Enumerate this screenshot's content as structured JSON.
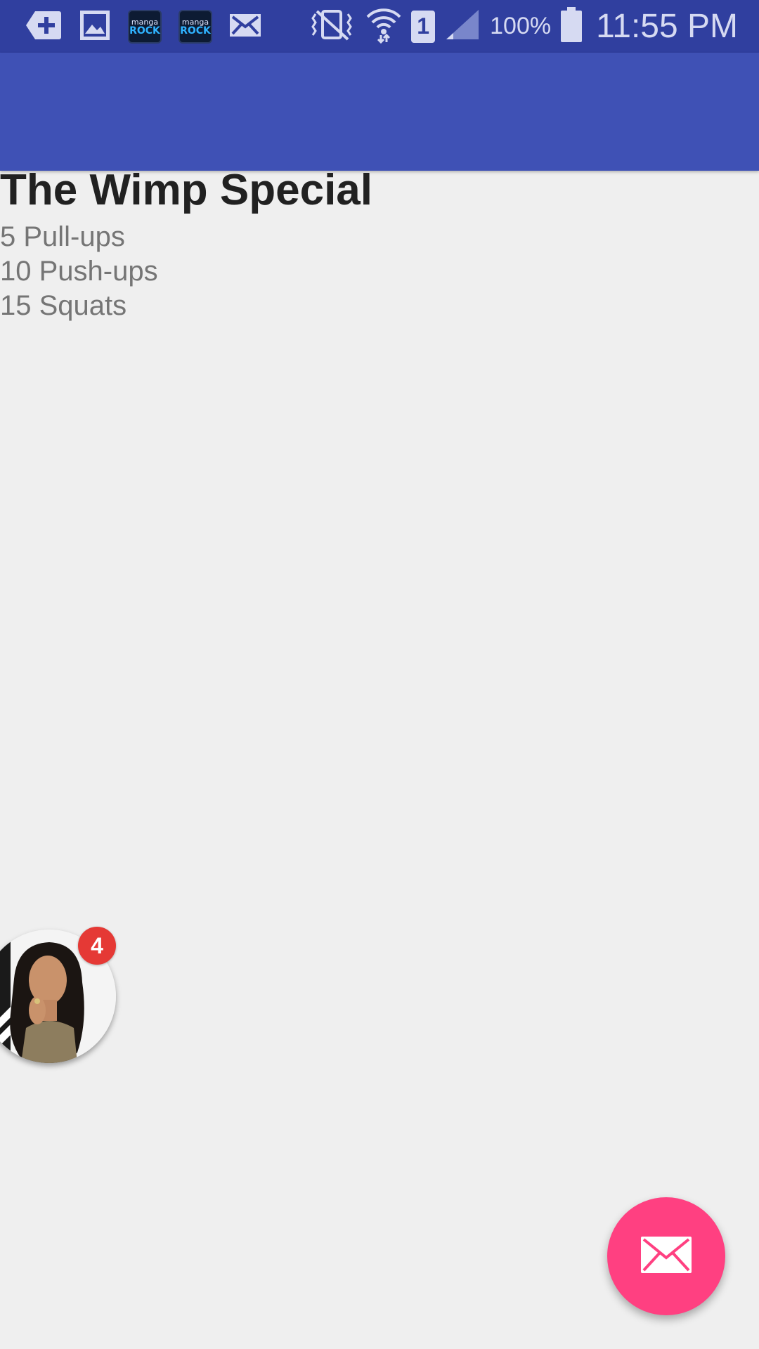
{
  "status_bar": {
    "left_icons": [
      "add-notification-icon",
      "gallery-icon",
      "manga-rock-icon",
      "manga-rock-icon",
      "mail-icon"
    ],
    "manga_label_top": "manga",
    "manga_label_bottom": "ROCK",
    "right_icons": [
      "vibrate-icon",
      "wifi-icon",
      "sim-icon",
      "signal-icon",
      "battery-icon"
    ],
    "sim_number": "1",
    "battery": "100%",
    "time": "11:55 PM"
  },
  "workout": {
    "title": "The Wimp Special",
    "exercises": [
      "5 Pull-ups",
      "10 Push-ups",
      "15 Squats"
    ]
  },
  "chat_head": {
    "badge_count": "4"
  },
  "fab": {
    "icon": "email-icon"
  },
  "colors": {
    "status_bar": "#303f9f",
    "app_bar": "#3f51b5",
    "background": "#efefef",
    "fab": "#ff4081",
    "badge": "#e53935"
  }
}
